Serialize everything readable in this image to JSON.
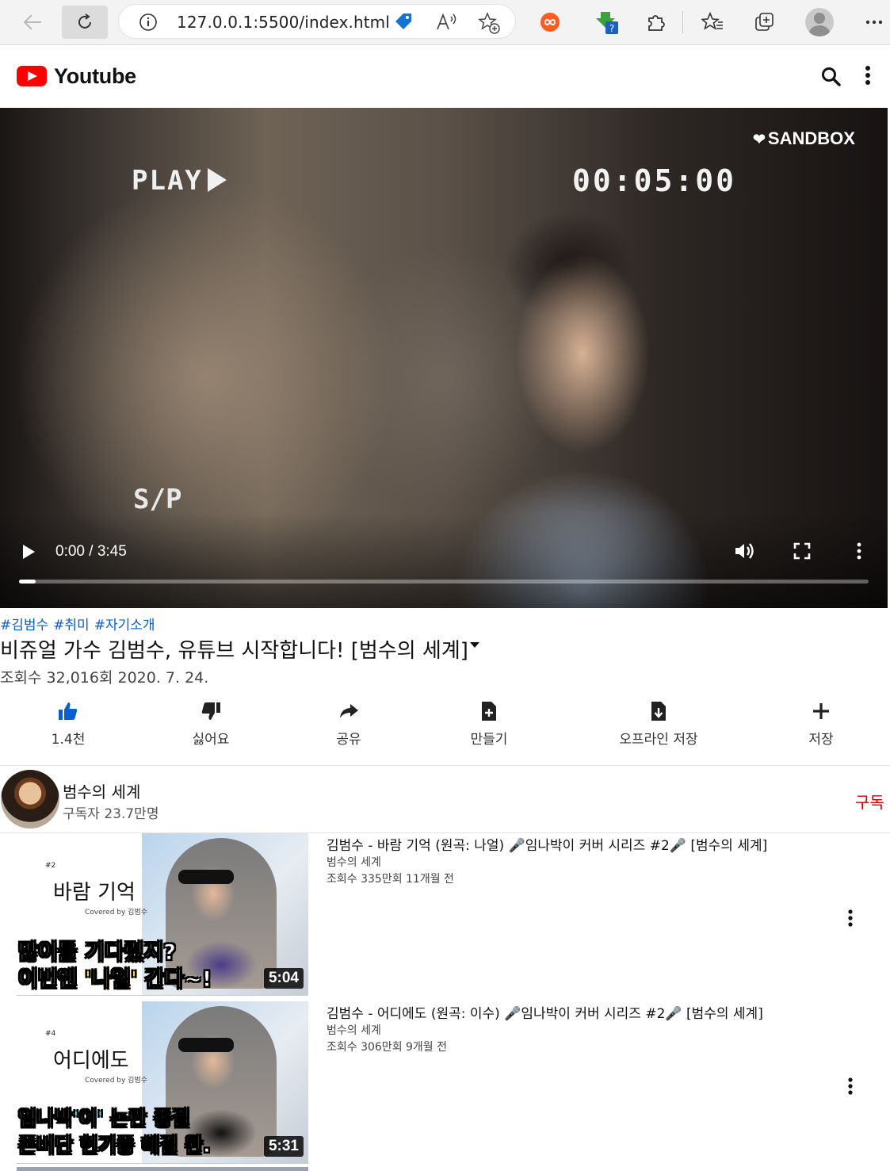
{
  "browser": {
    "url": "127.0.0.1:5500/index.html"
  },
  "header": {
    "title": "Youtube"
  },
  "video": {
    "overlay_play": "PLAY",
    "overlay_timecode": "00:05:00",
    "overlay_sp": "S/P",
    "overlay_brand": "SANDBOX",
    "time": "0:00 / 3:45",
    "progress": 0.02
  },
  "info": {
    "hashtags": [
      "#김범수",
      "#취미",
      "#자기소개"
    ],
    "title": "비쥬얼 가수 김범수, 유튜브 시작합니다! [범수의 세계]",
    "meta": "조회수 32,016회 2020. 7. 24."
  },
  "actions": [
    {
      "label": "1.4천",
      "icon": "thumb-up-icon"
    },
    {
      "label": "싫어요",
      "icon": "thumb-down-icon"
    },
    {
      "label": "공유",
      "icon": "share-icon"
    },
    {
      "label": "만들기",
      "icon": "create-file-icon"
    },
    {
      "label": "오프라인 저장",
      "icon": "download-file-icon"
    },
    {
      "label": "저장",
      "icon": "plus-icon"
    }
  ],
  "channel": {
    "name": "범수의 세계",
    "subscribers": "구독자 23.7만명",
    "subscribe_label": "구독"
  },
  "related": [
    {
      "title": "김범수 - 바람 기억 (원곡: 나얼) 🎤임나박이 커버 시리즈 #2🎤 [범수의 세계]",
      "channel": "범수의 세계",
      "meta": "조회수 335만회 11개월 전",
      "duration": "5:04",
      "thumb_number": "#2",
      "thumb_title": "바람 기억",
      "thumb_covered": "Covered by 김범수",
      "thumb_caption1": "많이들 기다렸지?",
      "thumb_caption2a": "이번엔 ",
      "thumb_caption2b": "'나얼'",
      "thumb_caption2c": " 간다~!"
    },
    {
      "title": "김범수 - 어디에도 (원곡: 이수) 🎤임나박이 커버 시리즈 #2🎤 [범수의 세계]",
      "channel": "범수의 세계",
      "meta": "조회수 306만회 9개월 전",
      "duration": "5:31",
      "thumb_number": "#4",
      "thumb_title": "어디에도",
      "thumb_covered": "Covered by 김범수",
      "thumb_caption1a": "임나박",
      "thumb_caption1b": "'이'",
      "thumb_caption1c": " 논란 ",
      "thumb_caption1d": "종결",
      "thumb_caption2a": "존버단 ",
      "thumb_caption2b": "현기증 해결",
      "thumb_caption2c": " 완."
    }
  ],
  "colors": {
    "brand_red": "#ff0000",
    "link_blue": "#065fd4",
    "subscribe_red": "#cc0000"
  }
}
